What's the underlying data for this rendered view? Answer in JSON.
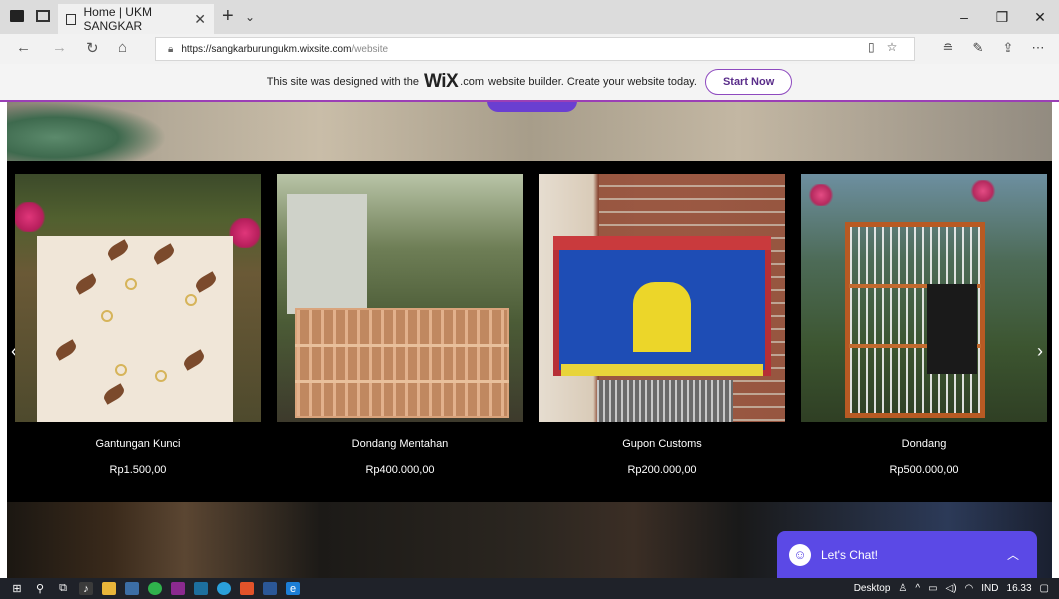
{
  "browser": {
    "tab_title": "Home | UKM SANGKAR",
    "tab_close": "✕",
    "new_tab": "+",
    "tab_list": "⌄",
    "url_host": "https://sangkarburungukm.wixsite.com",
    "url_path": "/website",
    "win_minimize": "–",
    "win_restore": "❐",
    "win_close": "✕"
  },
  "wix_banner": {
    "text_before": "This site was designed with the",
    "logo": "WiX",
    "logo_suffix": ".com",
    "text_after": "website builder. Create your website today.",
    "cta": "Start Now"
  },
  "gallery": {
    "items": [
      {
        "title": "Gantungan Kunci",
        "price": "Rp1.500,00"
      },
      {
        "title": "Dondang Mentahan",
        "price": "Rp400.000,00"
      },
      {
        "title": "Gupon Customs",
        "price": "Rp200.000,00"
      },
      {
        "title": "Dondang",
        "price": "Rp500.000,00"
      }
    ],
    "prev": "‹",
    "next": "›"
  },
  "chat": {
    "label": "Let's Chat!",
    "chevron": "︿"
  },
  "taskbar": {
    "desktop": "Desktop",
    "lang": "IND",
    "time": "16.33"
  },
  "colors": {
    "wix_accent": "#9b3fb6",
    "chat_bg": "#5b49e6",
    "taskbar_bg": "#1f2229"
  }
}
